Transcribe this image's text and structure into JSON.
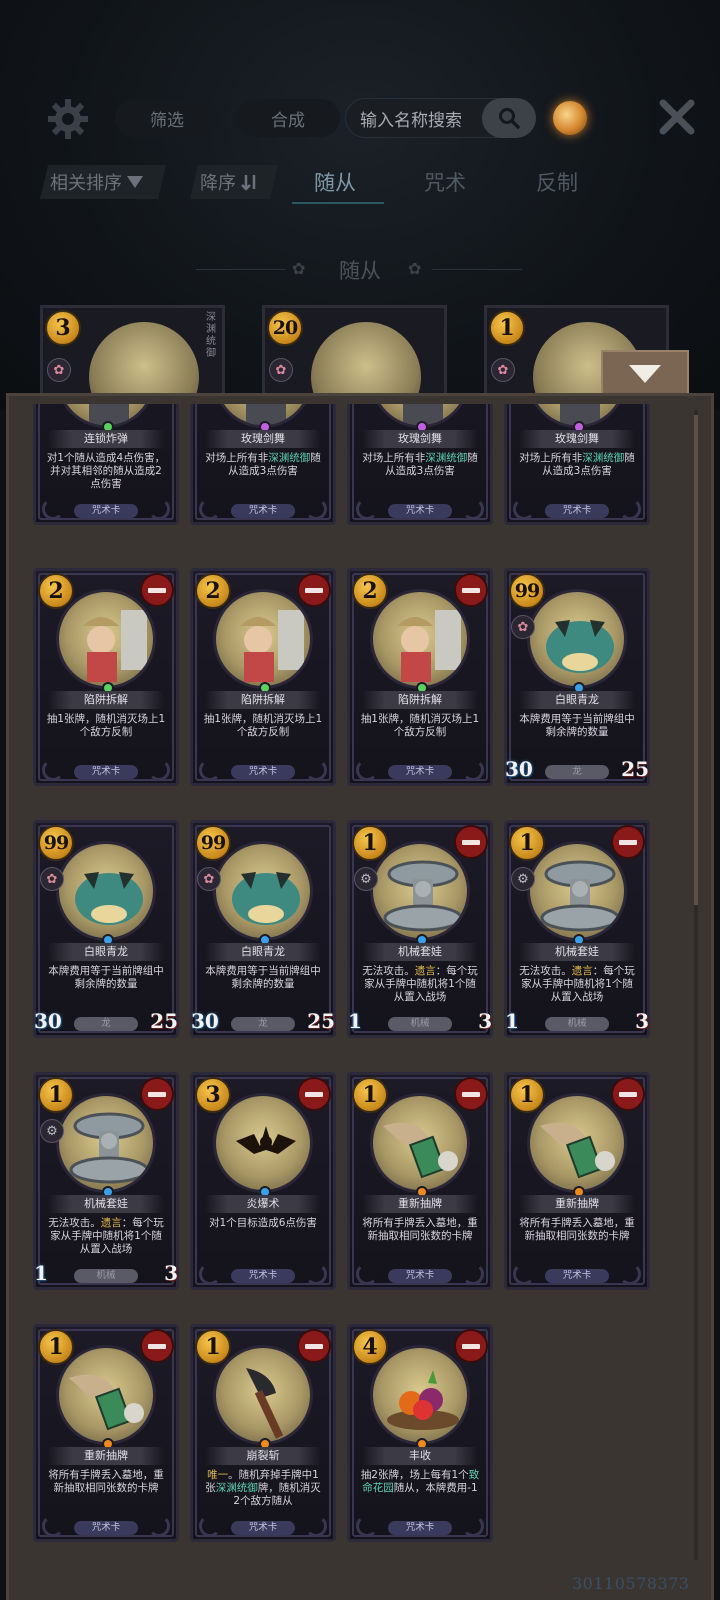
{
  "topbar": {
    "filter_label": "筛选",
    "craft_label": "合成",
    "search_placeholder": "输入名称搜索"
  },
  "sortbar": {
    "relevance_label": "相关排序",
    "order_label": "降序",
    "tabs": [
      "随从",
      "咒术",
      "反制"
    ],
    "active_tab": "随从"
  },
  "section": {
    "title": "随从"
  },
  "top_row": [
    {
      "cost": "3",
      "label": "深渊统御"
    },
    {
      "cost": "20",
      "label": ""
    },
    {
      "cost": "1",
      "label": ""
    }
  ],
  "cards": [
    {
      "name": "连锁炸弹",
      "desc": "对1个随从造成4点伤害，并对其相邻的随从造成2点伤害",
      "type": "咒术卡"
    },
    {
      "name": "玫瑰剑舞",
      "desc_pre": "对场上所有非",
      "desc_hl": "深渊统御",
      "desc_post": "随从造成3点伤害",
      "type": "咒术卡"
    },
    {
      "name": "玫瑰剑舞",
      "desc_pre": "对场上所有非",
      "desc_hl": "深渊统御",
      "desc_post": "随从造成3点伤害",
      "type": "咒术卡"
    },
    {
      "name": "玫瑰剑舞",
      "desc_pre": "对场上所有非",
      "desc_hl": "深渊统御",
      "desc_post": "随从造成3点伤害",
      "type": "咒术卡"
    },
    {
      "cost": "2",
      "name": "陷阱拆解",
      "desc": "抽1张牌，随机消灭场上1个敌方反制",
      "type": "咒术卡"
    },
    {
      "cost": "2",
      "name": "陷阱拆解",
      "desc": "抽1张牌，随机消灭场上1个敌方反制",
      "type": "咒术卡"
    },
    {
      "cost": "2",
      "name": "陷阱拆解",
      "desc": "抽1张牌，随机消灭场上1个敌方反制",
      "type": "咒术卡"
    },
    {
      "cost": "99",
      "name": "白眼青龙",
      "desc": "本牌费用等于当前牌组中剩余牌的数量",
      "type": "龙",
      "atk": "30",
      "hp": "25"
    },
    {
      "cost": "99",
      "name": "白眼青龙",
      "desc": "本牌费用等于当前牌组中剩余牌的数量",
      "type": "龙",
      "atk": "30",
      "hp": "25"
    },
    {
      "cost": "99",
      "name": "白眼青龙",
      "desc": "本牌费用等于当前牌组中剩余牌的数量",
      "type": "龙",
      "atk": "30",
      "hp": "25"
    },
    {
      "cost": "1",
      "name": "机械套娃",
      "desc_pre": "无法攻击。",
      "desc_gold": "遗言",
      "desc_post": "：每个玩家从手牌中随机将1个随从置入战场",
      "type": "机械",
      "atk": "1",
      "hp": "3"
    },
    {
      "cost": "1",
      "name": "机械套娃",
      "desc_pre": "无法攻击。",
      "desc_gold": "遗言",
      "desc_post": "：每个玩家从手牌中随机将1个随从置入战场",
      "type": "机械",
      "atk": "1",
      "hp": "3"
    },
    {
      "cost": "1",
      "name": "机械套娃",
      "desc_pre": "无法攻击。",
      "desc_gold": "遗言",
      "desc_post": "：每个玩家从手牌中随机将1个随从置入战场",
      "type": "机械",
      "atk": "1",
      "hp": "3"
    },
    {
      "cost": "3",
      "name": "炎爆术",
      "desc": "对1个目标造成6点伤害",
      "type": "咒术卡"
    },
    {
      "cost": "1",
      "name": "重新抽牌",
      "desc": "将所有手牌丢入墓地，重新抽取相同张数的卡牌",
      "type": "咒术卡"
    },
    {
      "cost": "1",
      "name": "重新抽牌",
      "desc": "将所有手牌丢入墓地，重新抽取相同张数的卡牌",
      "type": "咒术卡"
    },
    {
      "cost": "1",
      "name": "重新抽牌",
      "desc": "将所有手牌丢入墓地，重新抽取相同张数的卡牌",
      "type": "咒术卡"
    },
    {
      "cost": "1",
      "name": "崩裂斩",
      "desc_gold": "唯一",
      "desc_pre": "。随机弃掉手牌中1张",
      "desc_hl": "深渊统御",
      "desc_post": "牌，随机消灭2个敌方随从",
      "type": "咒术卡"
    },
    {
      "cost": "4",
      "name": "丰收",
      "desc_pre": "抽2张牌，场上每有1个",
      "desc_hl": "致命花园",
      "desc_post": "随从，本牌费用-1",
      "type": "咒术卡"
    }
  ],
  "watermark": "30110578373",
  "colors": {
    "accent_cost": "#e0a32a",
    "remove_red": "#8a1a1a",
    "highlight_teal": "#5ccfb4",
    "highlight_gold": "#e0b948"
  }
}
